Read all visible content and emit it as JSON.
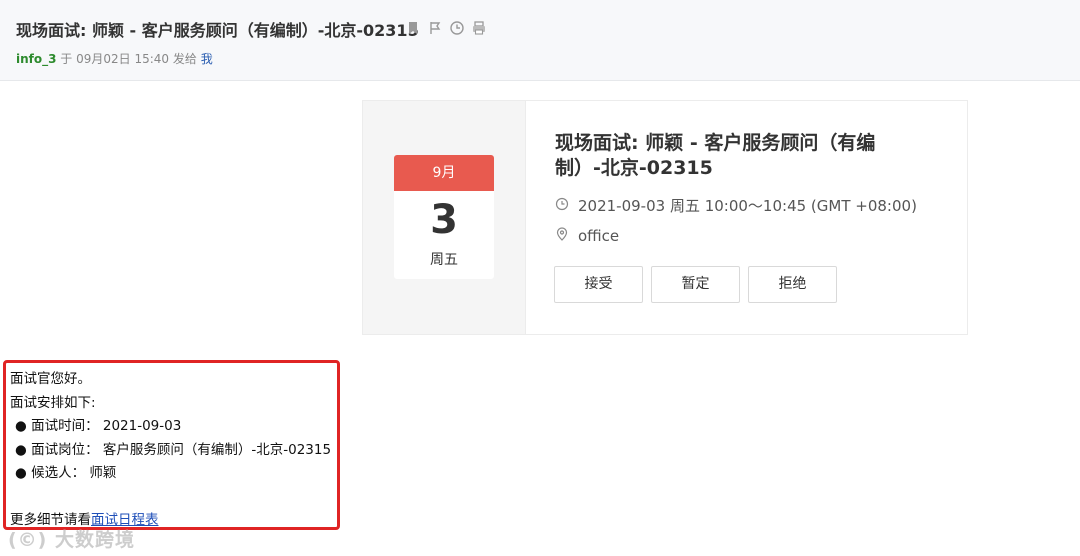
{
  "email": {
    "subject": "现场面试: 师颖 - 客户服务顾问（有编制）-北京-02315",
    "sender": "info_3",
    "meta_prefix": " 于 09月02日 15:40 发给 ",
    "recipient": "我",
    "header_icons": [
      "bookmark-icon",
      "flag-icon",
      "clock-icon",
      "print-icon"
    ]
  },
  "event": {
    "month": "9月",
    "day": "3",
    "weekday": "周五",
    "title": "现场面试: 师颖 - 客户服务顾问（有编制）-北京-02315",
    "time": "2021-09-03 周五 10:00～10:45 (GMT +08:00)",
    "location": "office",
    "accent_color": "#e85a4f",
    "buttons": {
      "accept": "接受",
      "tentative": "暂定",
      "decline": "拒绝"
    }
  },
  "body": {
    "greeting": "面试官您好。",
    "intro": "面试安排如下:",
    "items": [
      "● 面试时间： 2021-09-03",
      "● 面试岗位： 客户服务顾问（有编制）-北京-02315",
      "● 候选人： 师颖"
    ],
    "footer_text": "更多细节请看",
    "footer_link": "面试日程表",
    "highlight_color": "#e02424"
  },
  "watermark": "(©) 大数跨境"
}
